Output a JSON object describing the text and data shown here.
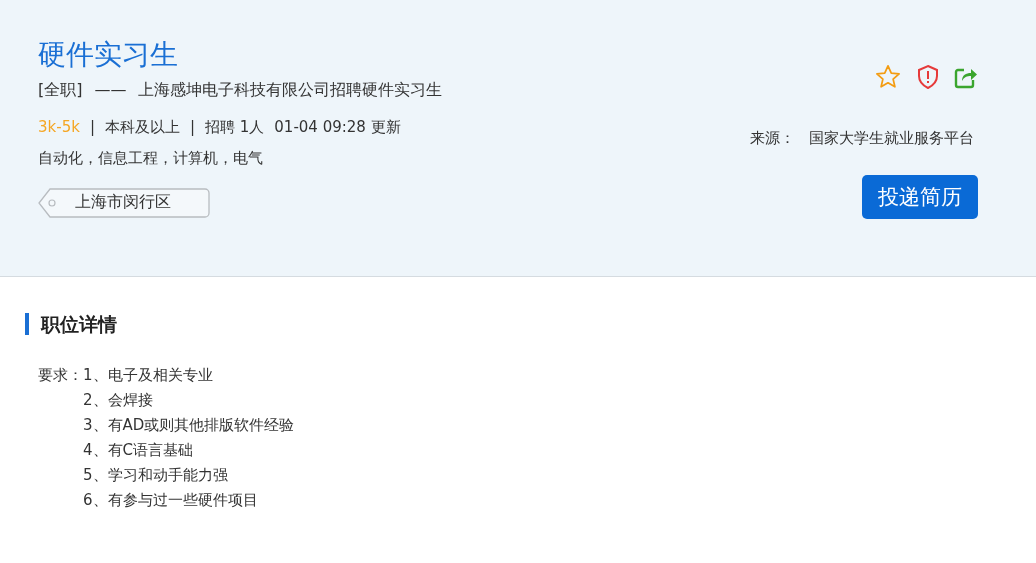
{
  "job": {
    "title": "硬件实习生",
    "type": "[全职]",
    "dash": "——",
    "company_line": "上海感坤电子科技有限公司招聘硬件实习生",
    "meta": [
      {
        "kind": "salary",
        "text": "3k-5k"
      },
      {
        "kind": "sep",
        "text": "|"
      },
      {
        "kind": "plain",
        "text": "本科及以上"
      },
      {
        "kind": "sep",
        "text": "|"
      },
      {
        "kind": "plain",
        "text": "招聘 1人"
      },
      {
        "kind": "plain",
        "text": "01-04 09:28 更新"
      }
    ],
    "majors": "自动化，信息工程，计算机，电气",
    "location": "上海市闵行区",
    "source_label": "来源：",
    "source": "国家大学生就业服务平台",
    "apply_button": "投递简历"
  },
  "details": {
    "heading": "职位详情",
    "label": "要求：",
    "items": [
      "1、电子及相关专业",
      "2、会焊接",
      "3、有AD或则其他排版软件经验",
      "4、有C语言基础",
      "5、学习和动手能力强",
      "6、有参与过一些硬件项目"
    ]
  }
}
